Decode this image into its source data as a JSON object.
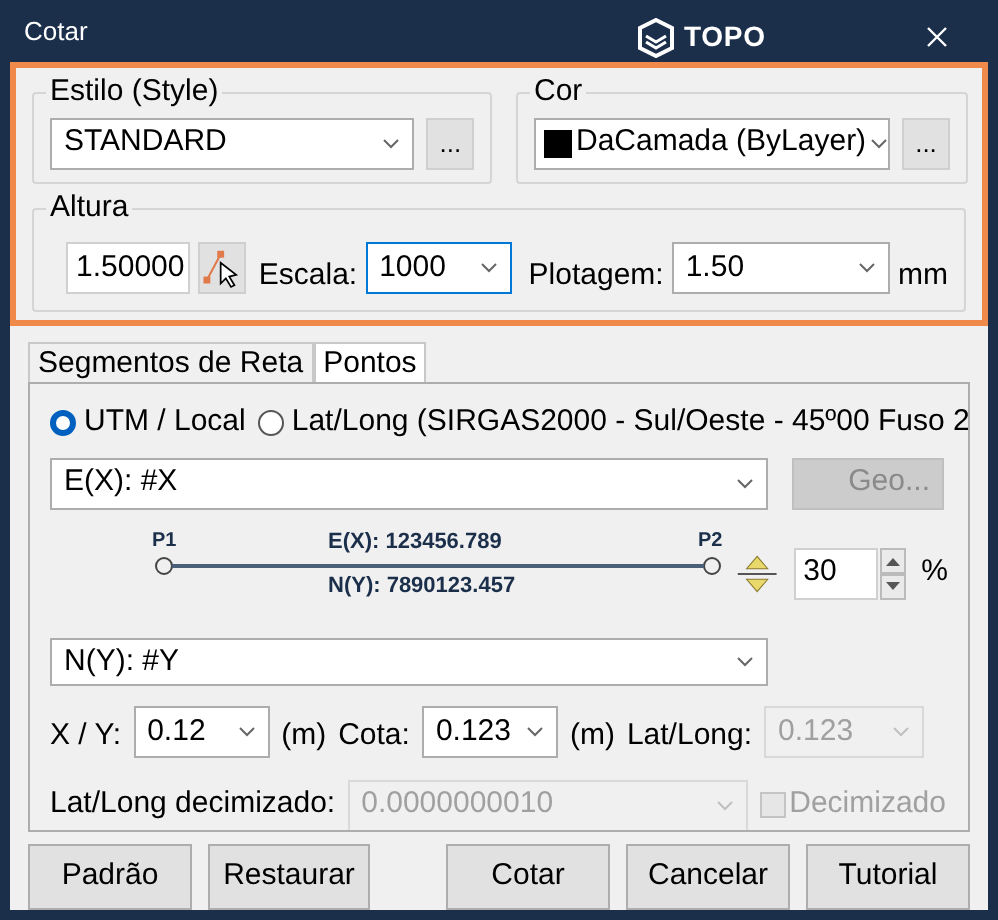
{
  "window": {
    "title": "Cotar",
    "logo": "TOPO"
  },
  "style_group": {
    "label": "Estilo (Style)",
    "value": "STANDARD",
    "more": "..."
  },
  "color_group": {
    "label": "Cor",
    "value": "DaCamada (ByLayer)",
    "color": "#000000",
    "more": "..."
  },
  "height_group": {
    "label": "Altura",
    "value": "1.50000",
    "scale_label": "Escala:",
    "scale_value": "1000",
    "scale_focused": true,
    "plot_label": "Plotagem:",
    "plot_value": "1.50",
    "unit": "mm"
  },
  "tabs": [
    {
      "label": "Segmentos de Reta",
      "selected": false
    },
    {
      "label": "Pontos",
      "selected": true
    }
  ],
  "coordinate_modes": [
    {
      "label": "UTM / Local",
      "selected": true
    },
    {
      "label": "Lat/Long (SIRGAS2000 - Sul/Oeste - 45º00 Fuso 2",
      "selected": false
    }
  ],
  "e_field": {
    "value": "E(X): #X"
  },
  "geo_button": {
    "label": "Geo...",
    "disabled": true
  },
  "preview": {
    "p1": "P1",
    "p2": "P2",
    "e": "E(X): 123456.789",
    "n": "N(Y): 7890123.457"
  },
  "offset": {
    "value": "30",
    "unit": "%"
  },
  "n_field": {
    "value": "N(Y): #Y"
  },
  "precision": [
    {
      "label": "X / Y:",
      "value": "0.12",
      "unit": "(m)",
      "disabled": false
    },
    {
      "label": "Cota:",
      "value": "0.123",
      "unit": "(m)",
      "disabled": false
    },
    {
      "label": "Lat/Long:",
      "value": "0.123",
      "disabled": true
    }
  ],
  "decimal": {
    "label": "Lat/Long decimizado:",
    "value": "0.0000000010",
    "disabled": true,
    "checkbox": {
      "label": "Decimizado",
      "checked": false,
      "disabled": true
    }
  },
  "buttons": [
    "Padrão",
    "Restaurar",
    "Cotar",
    "Cancelar",
    "Tutorial"
  ]
}
